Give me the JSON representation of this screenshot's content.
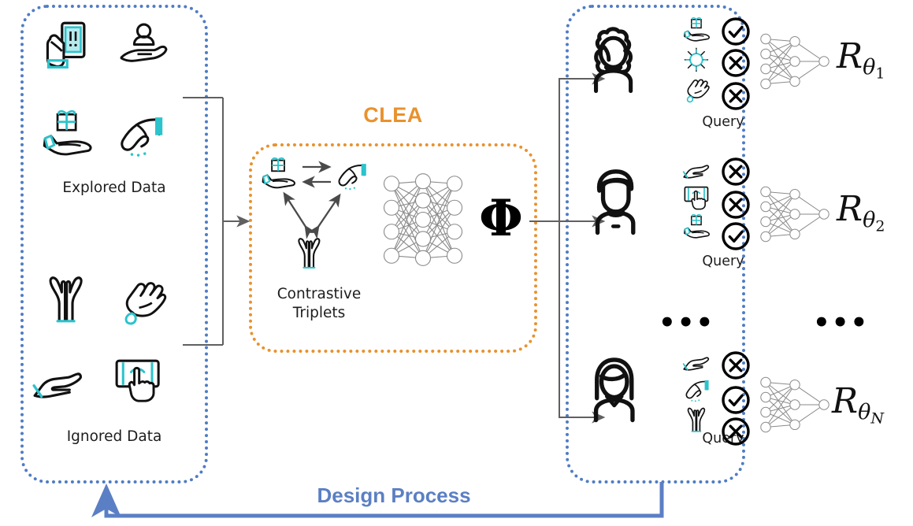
{
  "figure": {
    "type": "system-diagram",
    "title_overlay": "CLEA",
    "feedback_label": "Design Process"
  },
  "colors": {
    "accent_cyan": "#2cc3cc",
    "accent_orange": "#e8922e",
    "accent_blue": "#5b7fc4",
    "ink": "#111111",
    "net_gray": "#8a8a8a",
    "arrow_gray": "#606060"
  },
  "left_panel": {
    "name": "data-pool",
    "groups": [
      {
        "label": "Explored Data",
        "icons": [
          {
            "name": "hand-holding-phone-alert-icon"
          },
          {
            "name": "hand-offering-person-icon"
          },
          {
            "name": "hand-holding-gift-icon"
          },
          {
            "name": "hand-pinch-gesture-icon"
          }
        ]
      },
      {
        "label": "Ignored Data",
        "icons": [
          {
            "name": "two-open-hands-icon"
          },
          {
            "name": "hand-wave-gesture-icon"
          },
          {
            "name": "open-palm-hand-icon"
          },
          {
            "name": "finger-tap-touchscreen-icon"
          }
        ]
      }
    ]
  },
  "clea": {
    "title": "CLEA",
    "triplet_label_line1": "Contrastive",
    "triplet_label_line2": "Triplets",
    "triplet_icons": [
      {
        "name": "hand-holding-gift-icon",
        "role": "anchor"
      },
      {
        "name": "hand-pinch-gesture-icon",
        "role": "positive"
      },
      {
        "name": "two-open-hands-icon",
        "role": "negative"
      }
    ],
    "network": {
      "name": "embedding-network",
      "layers": [
        4,
        5,
        4
      ]
    },
    "embedding_symbol": "Φ"
  },
  "right_panel": {
    "name": "per-user-reward-models",
    "users": [
      {
        "avatar": "user-curly-hair-icon",
        "query_label": "Query",
        "queries": [
          {
            "icon": "hand-holding-gift-icon",
            "verdict": "check"
          },
          {
            "icon": "sun-icon",
            "verdict": "cross"
          },
          {
            "icon": "hand-wave-gesture-icon",
            "verdict": "cross"
          }
        ],
        "network": {
          "name": "reward-network",
          "layers": [
            4,
            3,
            1
          ]
        },
        "reward_label": "R",
        "reward_sub": "θ",
        "reward_index": "1"
      },
      {
        "avatar": "user-short-hair-icon",
        "query_label": "Query",
        "queries": [
          {
            "icon": "open-palm-hand-icon",
            "verdict": "cross"
          },
          {
            "icon": "finger-tap-touchscreen-icon",
            "verdict": "cross"
          },
          {
            "icon": "hand-holding-gift-icon",
            "verdict": "check"
          }
        ],
        "network": {
          "name": "reward-network",
          "layers": [
            4,
            3,
            1
          ]
        },
        "reward_label": "R",
        "reward_sub": "θ",
        "reward_index": "2"
      },
      {
        "avatar": "user-long-hair-icon",
        "query_label": "Query",
        "queries": [
          {
            "icon": "open-palm-hand-icon",
            "verdict": "cross"
          },
          {
            "icon": "hand-pinch-gesture-icon",
            "verdict": "check"
          },
          {
            "icon": "two-open-hands-icon",
            "verdict": "cross"
          }
        ],
        "network": {
          "name": "reward-network",
          "layers": [
            4,
            3,
            1
          ]
        },
        "reward_label": "R",
        "reward_sub": "θ",
        "reward_index": "N"
      }
    ],
    "users_ellipsis": "•••",
    "networks_ellipsis": "•••"
  }
}
